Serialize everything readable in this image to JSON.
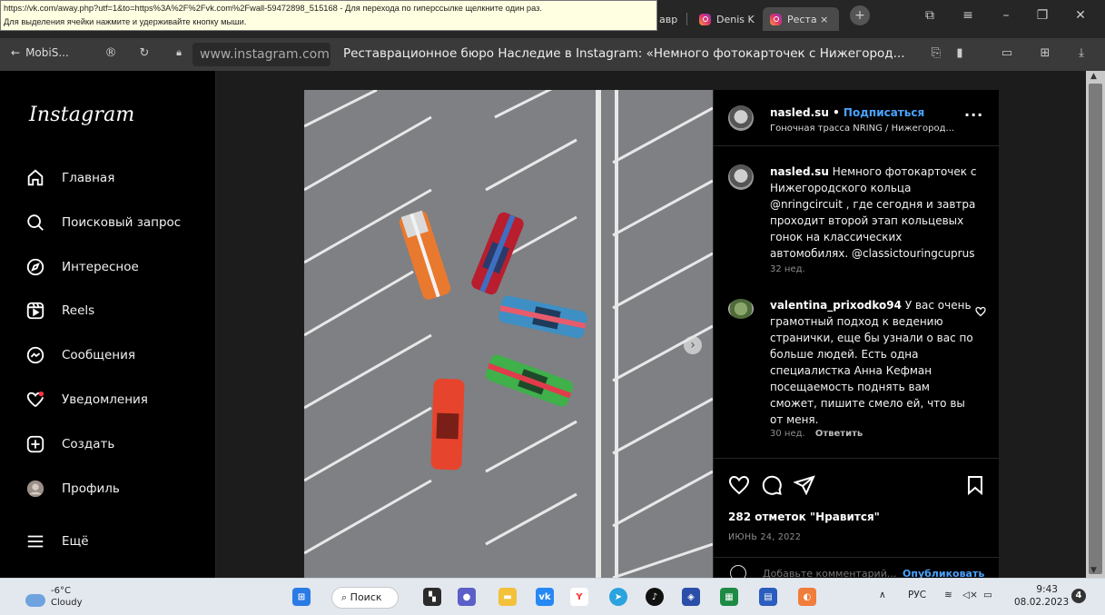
{
  "tooltip": {
    "line1": "https://vk.com/away.php?utf=1&to=https%3A%2F%2Fvk.com%2Fwall-59472898_515168 - Для перехода по гиперссылке щелкните один раз.",
    "line2": "Для выделения ячейки нажмите и удерживайте кнопку мыши."
  },
  "tabs": [
    {
      "label": "авр"
    },
    {
      "label": "Denis K"
    },
    {
      "label": "Реста ×"
    }
  ],
  "addressbar": {
    "back_label": "MobiS...",
    "url": "www.instagram.com",
    "page_title": "Реставрационное бюро Наследие в Instagram: «Немного фотокарточек с Нижегород..."
  },
  "sidebar": {
    "logo": "Instagram",
    "items": [
      {
        "label": "Главная",
        "icon": "home-icon"
      },
      {
        "label": "Поисковый запрос",
        "icon": "search-icon"
      },
      {
        "label": "Интересное",
        "icon": "compass-icon"
      },
      {
        "label": "Reels",
        "icon": "reels-icon"
      },
      {
        "label": "Сообщения",
        "icon": "messenger-icon"
      },
      {
        "label": "Уведомления",
        "icon": "heart-icon"
      },
      {
        "label": "Создать",
        "icon": "plus-icon"
      },
      {
        "label": "Профиль",
        "icon": "avatar-icon"
      },
      {
        "label": "Ещё",
        "icon": "menu-icon"
      }
    ]
  },
  "post": {
    "username": "nasled.su",
    "separator": "•",
    "follow_label": "Подписаться",
    "location": "Гоночная трасса NRING / Нижегород...",
    "caption_user": "nasled.su",
    "caption_text": "Немного фотокарточек с Нижегородского кольца @nringcircuit , где сегодня и завтра проходит второй этап кольцевых гонок на классических автомобилях. @classictouringcuprus",
    "caption_time": "32 нед.",
    "comment_user": "valentina_prixodko94",
    "comment_text": "У вас очень грамотный подход к ведению странички, еще бы узнали о вас по больше людей. Есть одна специалистка Анна Кефман посещаемость поднять вам сможет, пишите смело ей, что вы от меня.",
    "comment_time": "30 нед.",
    "reply_label": "Ответить",
    "likes": "282 отметок \"Нравится\"",
    "date": "ИЮНЬ 24, 2022",
    "add_comment_placeholder": "Добавьте комментарий...",
    "post_button": "Опубликовать"
  },
  "taskbar": {
    "temperature": "-6°C",
    "weather": "Cloudy",
    "search_label": "Поиск",
    "language": "РУС",
    "time": "9:43",
    "date": "08.02.2023",
    "notification_count": "4"
  }
}
